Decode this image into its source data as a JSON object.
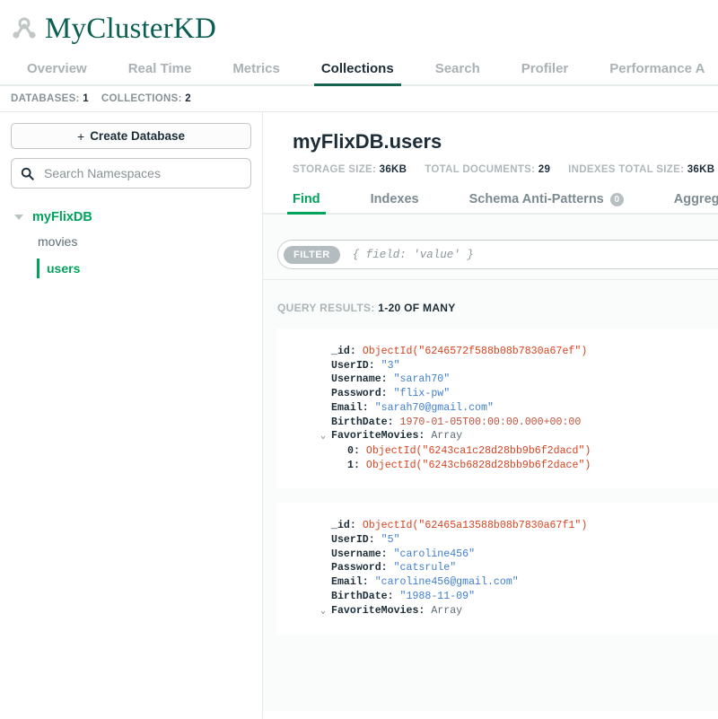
{
  "header": {
    "cluster_name": "MyClusterKD",
    "cluster_icon": "cluster-node-icon"
  },
  "top_tabs": [
    {
      "label": "Overview",
      "active": false
    },
    {
      "label": "Real Time",
      "active": false
    },
    {
      "label": "Metrics",
      "active": false
    },
    {
      "label": "Collections",
      "active": true
    },
    {
      "label": "Search",
      "active": false
    },
    {
      "label": "Profiler",
      "active": false
    },
    {
      "label": "Performance A",
      "active": false
    }
  ],
  "counts": {
    "databases_label": "DATABASES:",
    "databases_value": "1",
    "collections_label": "COLLECTIONS:",
    "collections_value": "2"
  },
  "sidebar": {
    "create_database_plus": "+",
    "create_database_label": "Create Database",
    "search_placeholder": "Search Namespaces",
    "search_value": "",
    "database": {
      "name": "myFlixDB",
      "expanded": true
    },
    "collections": [
      {
        "name": "movies",
        "selected": false
      },
      {
        "name": "users",
        "selected": true
      }
    ]
  },
  "main": {
    "namespace_title": "myFlixDB.users",
    "stats": [
      {
        "label": "STORAGE SIZE:",
        "value": "36KB"
      },
      {
        "label": "TOTAL DOCUMENTS:",
        "value": "29"
      },
      {
        "label": "INDEXES TOTAL SIZE:",
        "value": "36KB"
      }
    ],
    "sub_tabs": [
      {
        "label": "Find",
        "active": true,
        "badge": null
      },
      {
        "label": "Indexes",
        "active": false,
        "badge": null
      },
      {
        "label": "Schema Anti-Patterns",
        "active": false,
        "badge": "0"
      },
      {
        "label": "Aggregation",
        "active": false,
        "badge": null
      }
    ],
    "filter": {
      "pill_label": "FILTER",
      "placeholder": "{ field: 'value' }",
      "value": ""
    },
    "query_results_label": "QUERY RESULTS:",
    "query_results_value": "1-20 OF MANY",
    "documents": [
      {
        "lines": [
          {
            "key": "_id",
            "value": "ObjectId(\"6246572f588b08b7830a67ef\")",
            "vtype": "oid",
            "indent": "normal"
          },
          {
            "key": "UserID",
            "value": "\"3\"",
            "vtype": "str",
            "indent": "normal"
          },
          {
            "key": "Username",
            "value": "\"sarah70\"",
            "vtype": "str",
            "indent": "normal"
          },
          {
            "key": "Password",
            "value": "\"flix-pw\"",
            "vtype": "str",
            "indent": "normal"
          },
          {
            "key": "Email",
            "value": "\"sarah70@gmail.com\"",
            "vtype": "str",
            "indent": "normal"
          },
          {
            "key": "BirthDate",
            "value": "1970-01-05T00:00:00.000+00:00",
            "vtype": "date",
            "indent": "normal"
          },
          {
            "key": "FavoriteMovies",
            "value": "Array",
            "vtype": "type",
            "indent": "expandable",
            "chevron": "⌄"
          },
          {
            "key": "0",
            "value": "ObjectId(\"6243ca1c28d28bb9b6f2dacd\")",
            "vtype": "oid",
            "indent": "nested"
          },
          {
            "key": "1",
            "value": "ObjectId(\"6243cb6828d28bb9b6f2dace\")",
            "vtype": "oid",
            "indent": "nested"
          }
        ]
      },
      {
        "lines": [
          {
            "key": "_id",
            "value": "ObjectId(\"62465a13588b08b7830a67f1\")",
            "vtype": "oid",
            "indent": "normal"
          },
          {
            "key": "UserID",
            "value": "\"5\"",
            "vtype": "str",
            "indent": "normal"
          },
          {
            "key": "Username",
            "value": "\"caroline456\"",
            "vtype": "str",
            "indent": "normal"
          },
          {
            "key": "Password",
            "value": "\"catsrule\"",
            "vtype": "str",
            "indent": "normal"
          },
          {
            "key": "Email",
            "value": "\"caroline456@gmail.com\"",
            "vtype": "str",
            "indent": "normal"
          },
          {
            "key": "BirthDate",
            "value": "\"1988-11-09\"",
            "vtype": "str",
            "indent": "normal"
          },
          {
            "key": "FavoriteMovies",
            "value": "Array",
            "vtype": "type",
            "indent": "expandable",
            "chevron": "⌄"
          }
        ]
      }
    ]
  },
  "colors": {
    "brand_green": "#00a35c",
    "dark_green": "#13634f",
    "title_teal": "#0b5e52",
    "objectid_red": "#d8431f",
    "string_blue": "#3f7ed0",
    "text_dark": "#1c2d38",
    "muted_gray": "#889397"
  }
}
